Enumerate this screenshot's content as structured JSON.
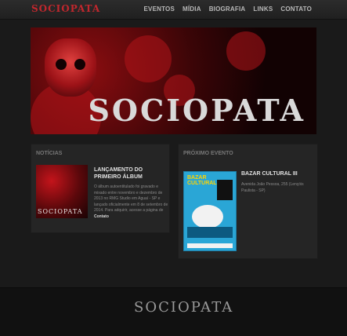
{
  "header": {
    "logo": "SOCIOPATA",
    "nav": [
      "EVENTOS",
      "MÍDIA",
      "BIOGRAFIA",
      "LINKS",
      "CONTATO"
    ]
  },
  "banner": {
    "title": "SOCIOPATA"
  },
  "news": {
    "section_title": "NOTÍCIAS",
    "image_text": "SOCIOPATA",
    "heading": "LANÇAMENTO DO PRIMEIRO ÁLBUM",
    "body": "O álbum autoentitulado foi gravado e mixado entre novembro e dezembro de 2013 no RMG Studio em Aguaí - SP e lançado oficialmente em 8 de setembro de 2014. Para adquirir, acesse a página de",
    "link": "Contato"
  },
  "event": {
    "section_title": "PRÓXIMO EVENTO",
    "poster_text": "BAZAR CULTURAL",
    "title": "BAZAR CULTURAL III",
    "address": "Avenida João Pessoa, 255 (Lençóis Paulista - SP)"
  },
  "footer": {
    "logo": "SOCIOPATA"
  },
  "colors": {
    "accent": "#c1272d",
    "background": "#1a1a1a"
  }
}
